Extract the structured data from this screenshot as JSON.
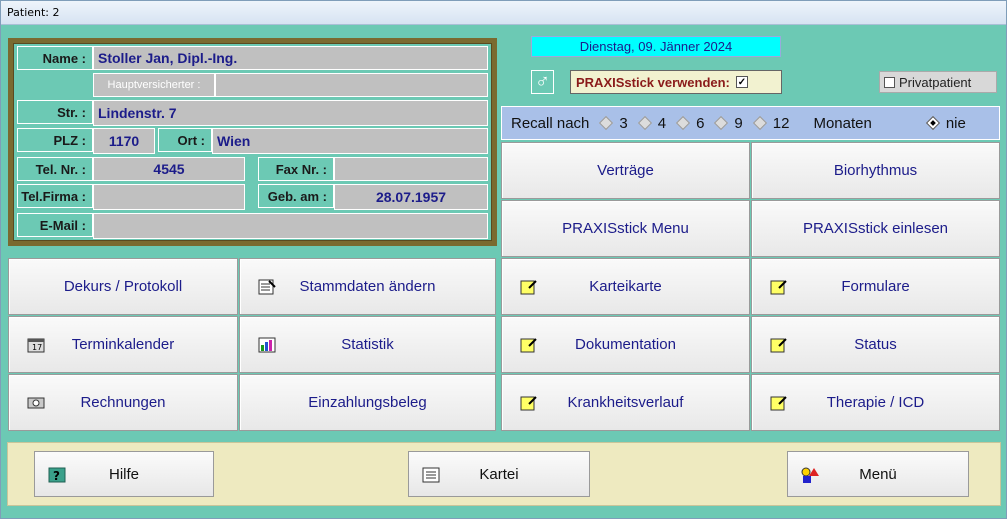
{
  "window": {
    "title": "Patient: 2"
  },
  "patient": {
    "name_label": "Name :",
    "name_value": "Stoller Jan, Dipl.-Ing.",
    "hauptversicherter_label": "Hauptversicherter :",
    "hauptversicherter_value": "",
    "street_label": "Str. :",
    "street_value": "Lindenstr. 7",
    "plz_label": "PLZ :",
    "plz_value": "1170",
    "ort_label": "Ort :",
    "ort_value": "Wien",
    "tel_label": "Tel. Nr. :",
    "tel_value": "4545",
    "fax_label": "Fax Nr. :",
    "fax_value": "",
    "telfirma_label": "Tel.Firma :",
    "telfirma_value": "",
    "geb_label": "Geb. am :",
    "geb_value": "28.07.1957",
    "email_label": "E-Mail :",
    "email_value": ""
  },
  "header": {
    "date": "Dienstag, 09. Jänner 2024",
    "gender_icon": "male-icon",
    "praxis_label": "PRAXISstick verwenden:",
    "praxis_checked": true,
    "privat_label": "Privatpatient",
    "privat_checked": false
  },
  "recall": {
    "label": "Recall nach",
    "options": [
      "3",
      "4",
      "6",
      "9",
      "12"
    ],
    "suffix": "Monaten",
    "never_label": "nie",
    "selected": "nie"
  },
  "buttons": {
    "vertraege": "Verträge",
    "biorhythmus": "Biorhythmus",
    "praxis_menu": "PRAXISstick Menu",
    "praxis_einlesen": "PRAXISstick einlesen",
    "dekurs": "Dekurs / Protokoll",
    "stammdaten": "Stammdaten ändern",
    "karteikarte": "Karteikarte",
    "formulare": "Formulare",
    "terminkalender": "Terminkalender",
    "statistik": "Statistik",
    "dokumentation": "Dokumentation",
    "status": "Status",
    "rechnungen": "Rechnungen",
    "einzahlungsbeleg": "Einzahlungsbeleg",
    "krankheitsverlauf": "Krankheitsverlauf",
    "therapie": "Therapie / ICD"
  },
  "bottom": {
    "hilfe": "Hilfe",
    "kartei": "Kartei",
    "menue": "Menü"
  },
  "colors": {
    "background": "#6cc9b4",
    "field": "#c0c0c0",
    "value_text": "#1c1c8a",
    "date_bg": "#00ffff",
    "recall_bg": "#a9c0e8",
    "bottom_bg": "#eeeac0",
    "panel_border": "#7a6a30"
  }
}
